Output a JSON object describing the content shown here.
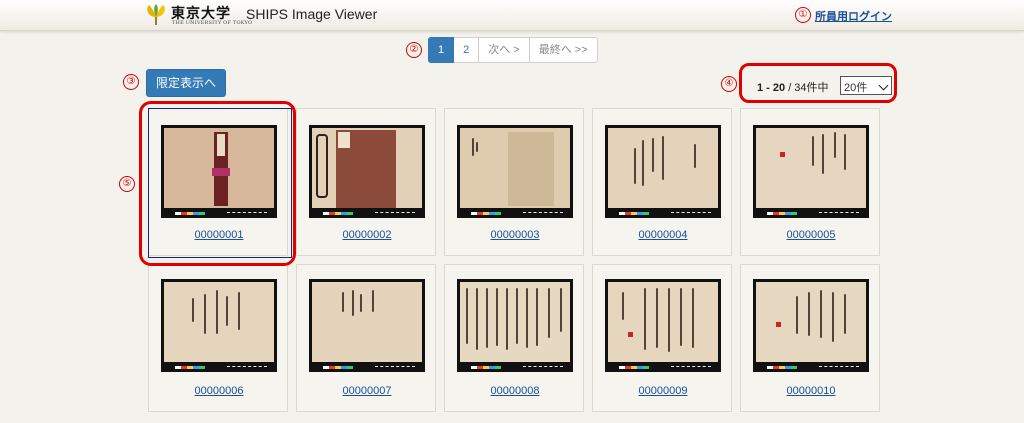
{
  "header": {
    "logo_ja": "東京大学",
    "logo_en": "THE UNIVERSITY OF TOKYO",
    "app_title": "SHIPS Image Viewer",
    "login_label": "所員用ログイン"
  },
  "markers": [
    "①",
    "②",
    "③",
    "④",
    "⑤"
  ],
  "pagination": {
    "pages": [
      "1",
      "2"
    ],
    "current": "1",
    "next_label": "次へ >",
    "last_label": "最終へ >>"
  },
  "limit_button": "限定表示へ",
  "results": {
    "range": "1 - 20",
    "total": " / 34件中",
    "per_page": "20件"
  },
  "items": [
    {
      "id": "00000001"
    },
    {
      "id": "00000002"
    },
    {
      "id": "00000003"
    },
    {
      "id": "00000004"
    },
    {
      "id": "00000005"
    },
    {
      "id": "00000006"
    },
    {
      "id": "00000007"
    },
    {
      "id": "00000008"
    },
    {
      "id": "00000009"
    },
    {
      "id": "00000010"
    }
  ],
  "colors": {
    "primary": "#337ab7",
    "annotation": "#e00000",
    "link": "#1a4f9a",
    "background": "#f4f2ec"
  }
}
